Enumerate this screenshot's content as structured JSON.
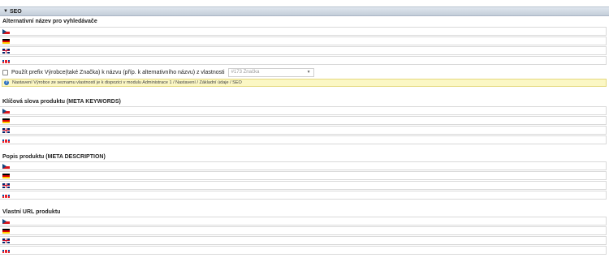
{
  "panel": {
    "title": "SEO",
    "toggle_icon": "triangle-down-icon"
  },
  "sections": {
    "alt_name": {
      "title": "Alternativní název pro vyhledávače"
    },
    "keywords": {
      "title": "Klíčová slova produktu (META KEYWORDS)"
    },
    "description": {
      "title": "Popis produktu (META DESCRIPTION)"
    },
    "url": {
      "title": "Vlastní URL produktu"
    }
  },
  "languages": [
    "cz",
    "de",
    "gb",
    "sk"
  ],
  "prefix_option": {
    "label": "Použít prefix Výrobce(také Značka) k názvu (příp. k alternativního názvu) z vlastnosti",
    "checked": false,
    "select_value": "#173 Značka"
  },
  "info": {
    "icon": "question-icon",
    "text": "Nastavení Výrobce ze seznamu vlastností je k dispozici v modulu Administrace 1 / Nastavení / Základní údaje / SEO"
  },
  "colors": {
    "header_bg": "#c9d3de",
    "info_bg": "#fbf7c4",
    "border": "#d9d9d9"
  }
}
